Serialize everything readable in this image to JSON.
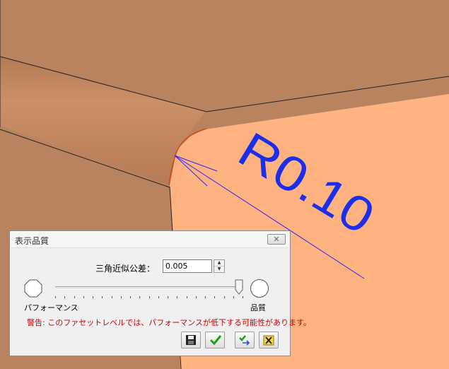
{
  "viewport": {
    "annotation": "R0.10",
    "colors": {
      "background_face": "#b98360",
      "rod_face": "#c98d67",
      "rod_shade": "#b27a55",
      "part_face": "#ffb381",
      "edge_line": "#222222",
      "fillet_edge": "#d24b1a",
      "leader": "#2a2aff",
      "annotation_text": "#1b2ee8"
    }
  },
  "dialog": {
    "title": "表示品質",
    "close_icon": "close-icon",
    "tolerance_label": "三角近似公差：",
    "tolerance_value": "0.005",
    "slider": {
      "level": 1.0,
      "tick_count": 21
    },
    "left_label": "パフォーマンス",
    "right_label": "品質",
    "warning": "警告: このファセットレベルでは、パフォーマンスが低下する可能性があります。",
    "buttons": [
      {
        "icon": "save-icon"
      },
      {
        "icon": "checkmark-icon"
      },
      {
        "icon": "apply-icon"
      },
      {
        "icon": "cancel-icon"
      }
    ],
    "colors": {
      "warning": "#cc0000",
      "check": "#1aa31a"
    }
  }
}
